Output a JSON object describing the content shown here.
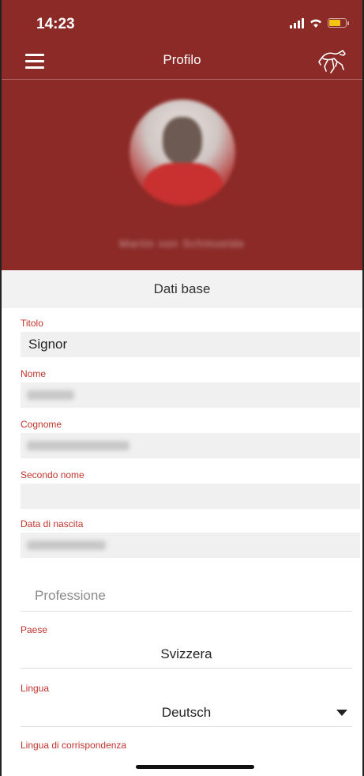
{
  "status_bar": {
    "time": "14:23"
  },
  "nav": {
    "title": "Profilo",
    "menu_icon": "hamburger-menu-icon",
    "logo_icon": "horse-logo-icon"
  },
  "profile": {
    "name": "Martin von Schmoelde"
  },
  "section": {
    "title": "Dati base"
  },
  "form": {
    "titolo": {
      "label": "Titolo",
      "value": "Signor"
    },
    "nome": {
      "label": "Nome",
      "value": "Martin"
    },
    "cognome": {
      "label": "Cognome",
      "value": "von Schmoelde"
    },
    "secondo_nome": {
      "label": "Secondo nome",
      "value": ""
    },
    "data_nascita": {
      "label": "Data di nascita",
      "value": "11.02.1970"
    },
    "professione": {
      "placeholder": "Professione"
    },
    "paese": {
      "label": "Paese",
      "value": "Svizzera"
    },
    "lingua": {
      "label": "Lingua",
      "value": "Deutsch"
    },
    "lingua_corrispondenza": {
      "label": "Lingua di corrispondenza"
    }
  },
  "colors": {
    "brand": "#8b2a27",
    "label": "#c0332c",
    "field_bg": "#f0f0f0",
    "section_bg": "#f2f2f2"
  }
}
